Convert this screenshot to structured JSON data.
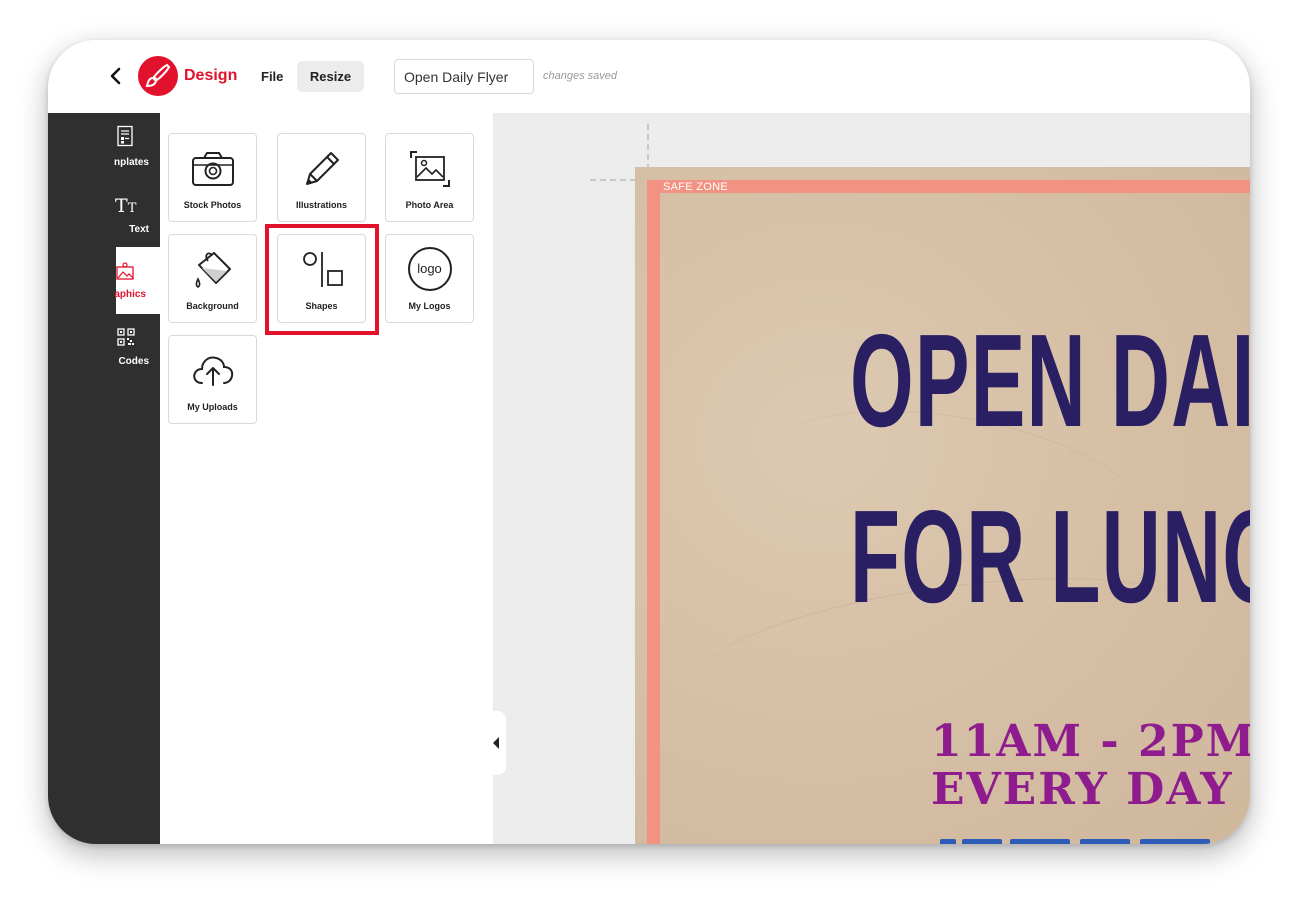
{
  "header": {
    "brand": "Design",
    "menu": {
      "file": "File",
      "resize": "Resize"
    },
    "document_name": "Open Daily Flyer",
    "save_status": "changes saved"
  },
  "rail": {
    "items": [
      {
        "label": "nplates",
        "icon": "templates-icon"
      },
      {
        "label": "Text",
        "icon": "text-icon"
      },
      {
        "label": "aphics",
        "icon": "graphics-icon",
        "active": true
      },
      {
        "label": "Codes",
        "icon": "qr-code-icon"
      }
    ]
  },
  "panel": {
    "tiles": [
      {
        "label": "Stock Photos",
        "icon": "camera-icon"
      },
      {
        "label": "Illustrations",
        "icon": "pencil-icon"
      },
      {
        "label": "Photo Area",
        "icon": "photo-area-icon"
      },
      {
        "label": "Background",
        "icon": "paint-bucket-icon"
      },
      {
        "label": "Shapes",
        "icon": "shapes-icon",
        "highlighted": true
      },
      {
        "label": "My Logos",
        "icon": "logo-icon",
        "icon_text": "logo"
      },
      {
        "label": "My Uploads",
        "icon": "cloud-upload-icon"
      }
    ]
  },
  "canvas": {
    "safe_zone_label": "SAFE ZONE",
    "headline_lines": [
      "OPEN DAI",
      "FOR LUNC"
    ],
    "hours_lines": [
      "11AM - 2PM",
      "EVERY DAY"
    ]
  },
  "colors": {
    "accent": "#e3122c",
    "rail": "#2f2f2f",
    "headline": "#2a1f63",
    "hours": "#8e1c8e",
    "safe_zone": "#f29283",
    "flyer_bg": "#d6c0a6"
  }
}
